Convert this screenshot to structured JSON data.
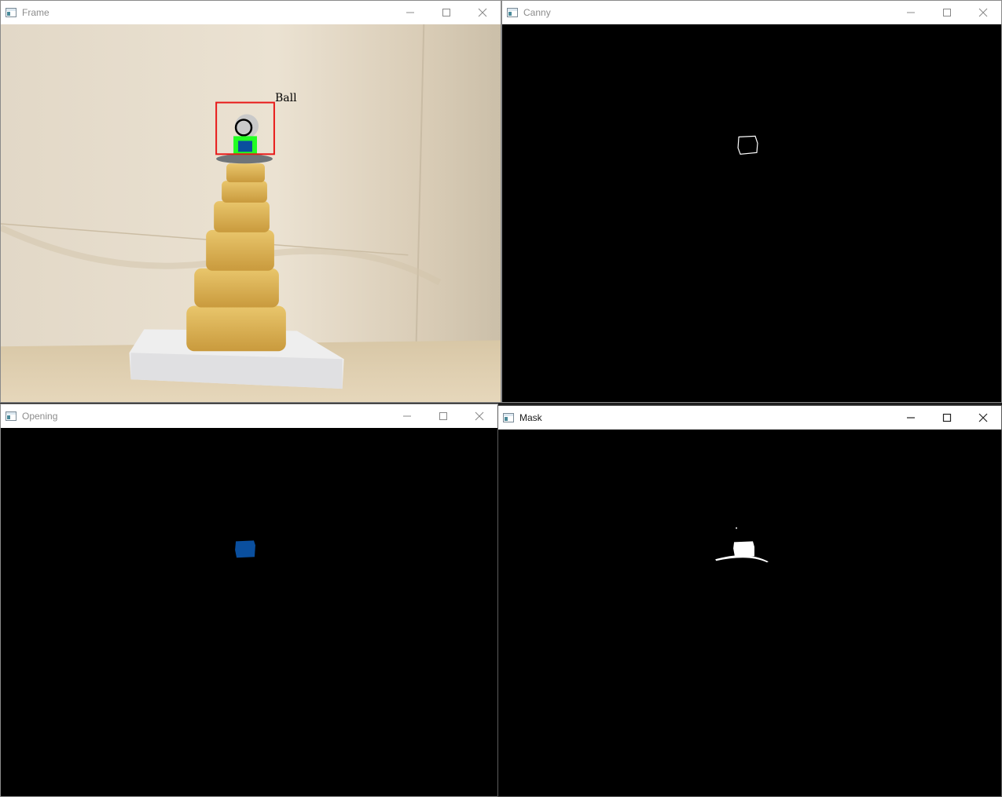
{
  "windows": {
    "frame": {
      "title": "Frame",
      "label": "Ball"
    },
    "canny": {
      "title": "Canny"
    },
    "opening": {
      "title": "Opening"
    },
    "mask": {
      "title": "Mask"
    }
  },
  "controls": {
    "minimize": "minimize-icon",
    "maximize": "maximize-icon",
    "close": "close-icon"
  },
  "colors": {
    "bounding_box": "#e81818",
    "contour": "#22ff22",
    "object_blue": "#0a4f9e"
  }
}
